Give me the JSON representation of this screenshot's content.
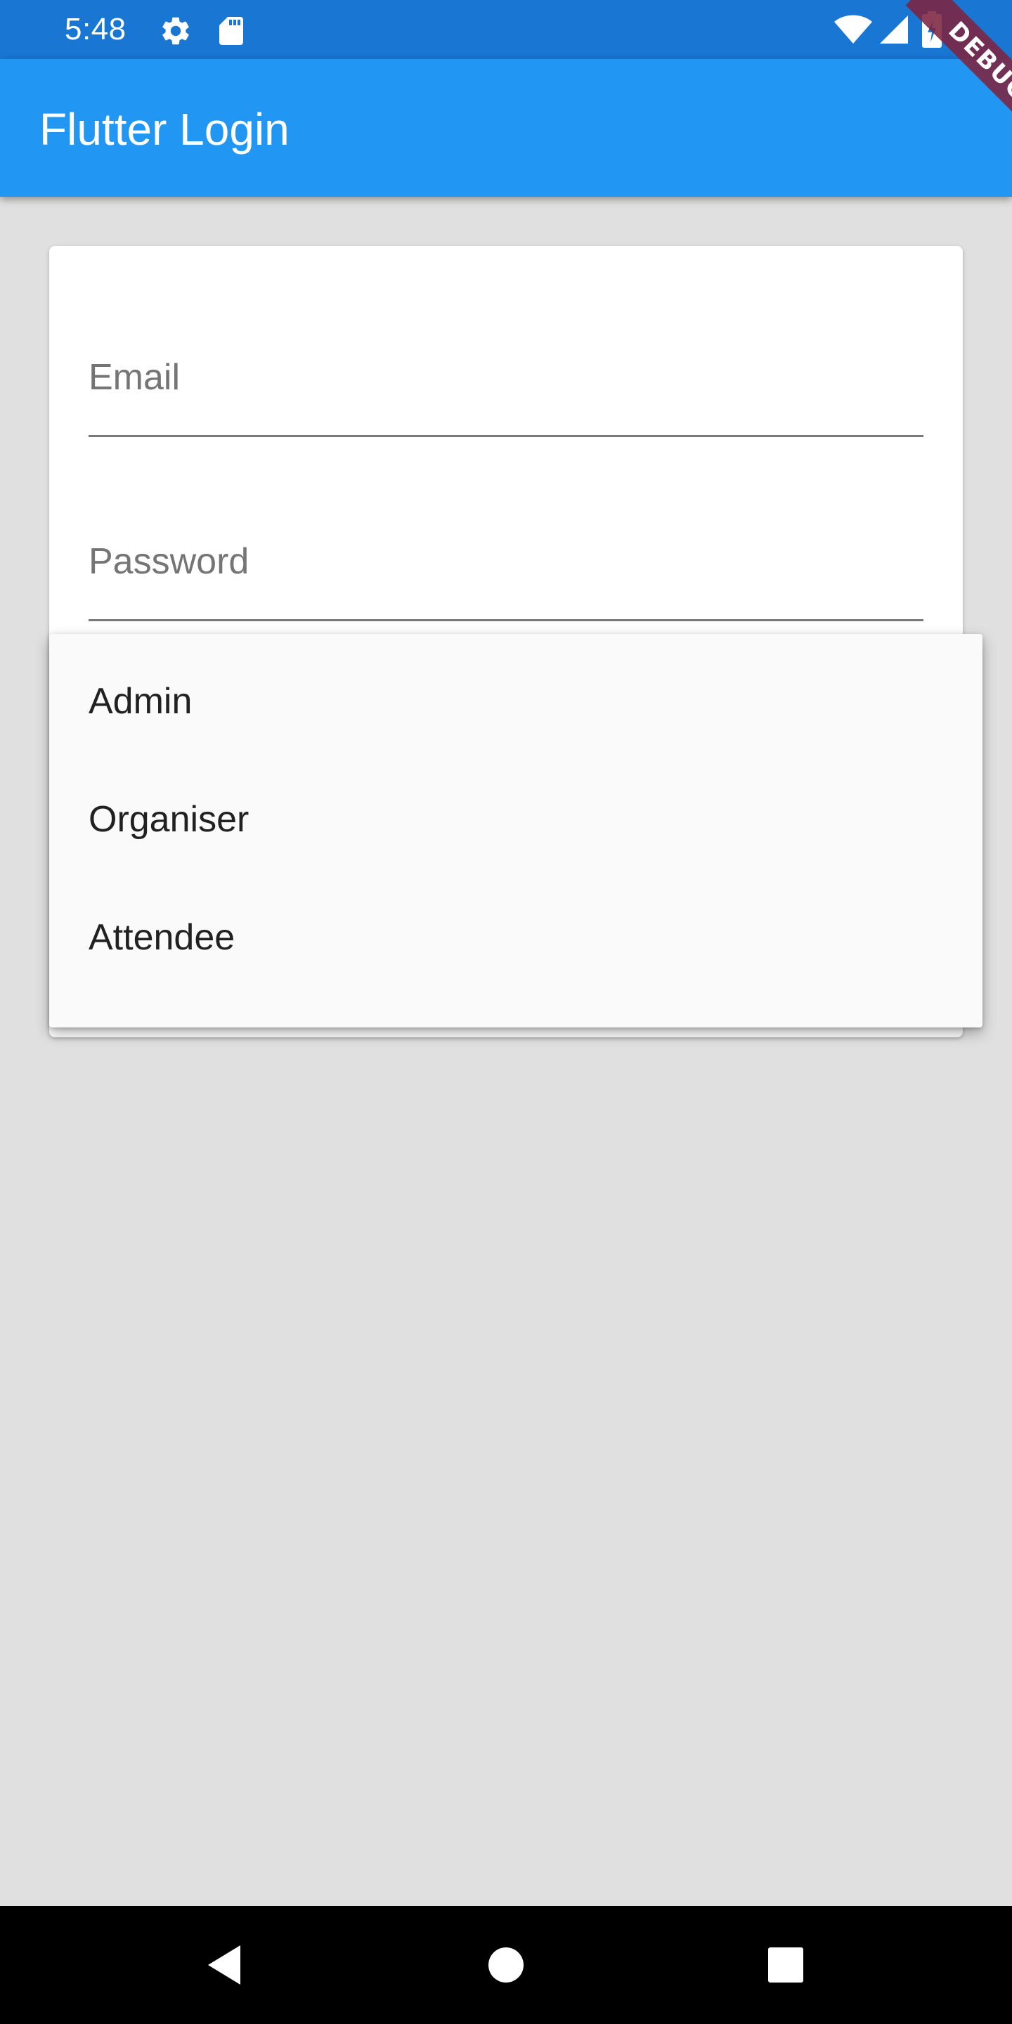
{
  "status_bar": {
    "time": "5:48",
    "icons": [
      "gear-icon",
      "sd-card-icon",
      "wifi-icon",
      "signal-icon",
      "battery-icon"
    ]
  },
  "app_bar": {
    "title": "Flutter Login"
  },
  "debug_banner": {
    "label": "DEBUG"
  },
  "form": {
    "email_label": "Email",
    "password_label": "Password"
  },
  "dropdown": {
    "options": [
      "Admin",
      "Organiser",
      "Attendee"
    ]
  },
  "nav_bar": {
    "buttons": [
      "back-icon",
      "home-icon",
      "recents-icon"
    ]
  },
  "colors": {
    "status_bar": "#1976D2",
    "app_bar": "#2196F3",
    "background": "#E0E0E0",
    "menu": "#FAFAFA",
    "debug_ribbon": "#7D2440"
  }
}
